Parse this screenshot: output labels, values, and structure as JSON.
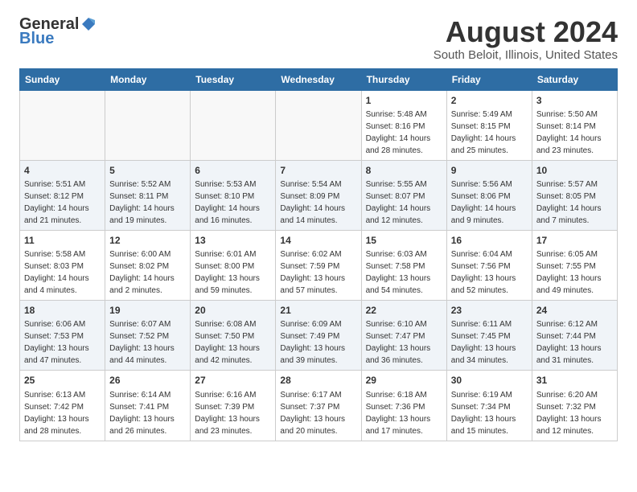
{
  "header": {
    "logo_general": "General",
    "logo_blue": "Blue",
    "title": "August 2024",
    "subtitle": "South Beloit, Illinois, United States"
  },
  "weekdays": [
    "Sunday",
    "Monday",
    "Tuesday",
    "Wednesday",
    "Thursday",
    "Friday",
    "Saturday"
  ],
  "weeks": [
    [
      {
        "day": "",
        "info": ""
      },
      {
        "day": "",
        "info": ""
      },
      {
        "day": "",
        "info": ""
      },
      {
        "day": "",
        "info": ""
      },
      {
        "day": "1",
        "info": "Sunrise: 5:48 AM\nSunset: 8:16 PM\nDaylight: 14 hours\nand 28 minutes."
      },
      {
        "day": "2",
        "info": "Sunrise: 5:49 AM\nSunset: 8:15 PM\nDaylight: 14 hours\nand 25 minutes."
      },
      {
        "day": "3",
        "info": "Sunrise: 5:50 AM\nSunset: 8:14 PM\nDaylight: 14 hours\nand 23 minutes."
      }
    ],
    [
      {
        "day": "4",
        "info": "Sunrise: 5:51 AM\nSunset: 8:12 PM\nDaylight: 14 hours\nand 21 minutes."
      },
      {
        "day": "5",
        "info": "Sunrise: 5:52 AM\nSunset: 8:11 PM\nDaylight: 14 hours\nand 19 minutes."
      },
      {
        "day": "6",
        "info": "Sunrise: 5:53 AM\nSunset: 8:10 PM\nDaylight: 14 hours\nand 16 minutes."
      },
      {
        "day": "7",
        "info": "Sunrise: 5:54 AM\nSunset: 8:09 PM\nDaylight: 14 hours\nand 14 minutes."
      },
      {
        "day": "8",
        "info": "Sunrise: 5:55 AM\nSunset: 8:07 PM\nDaylight: 14 hours\nand 12 minutes."
      },
      {
        "day": "9",
        "info": "Sunrise: 5:56 AM\nSunset: 8:06 PM\nDaylight: 14 hours\nand 9 minutes."
      },
      {
        "day": "10",
        "info": "Sunrise: 5:57 AM\nSunset: 8:05 PM\nDaylight: 14 hours\nand 7 minutes."
      }
    ],
    [
      {
        "day": "11",
        "info": "Sunrise: 5:58 AM\nSunset: 8:03 PM\nDaylight: 14 hours\nand 4 minutes."
      },
      {
        "day": "12",
        "info": "Sunrise: 6:00 AM\nSunset: 8:02 PM\nDaylight: 14 hours\nand 2 minutes."
      },
      {
        "day": "13",
        "info": "Sunrise: 6:01 AM\nSunset: 8:00 PM\nDaylight: 13 hours\nand 59 minutes."
      },
      {
        "day": "14",
        "info": "Sunrise: 6:02 AM\nSunset: 7:59 PM\nDaylight: 13 hours\nand 57 minutes."
      },
      {
        "day": "15",
        "info": "Sunrise: 6:03 AM\nSunset: 7:58 PM\nDaylight: 13 hours\nand 54 minutes."
      },
      {
        "day": "16",
        "info": "Sunrise: 6:04 AM\nSunset: 7:56 PM\nDaylight: 13 hours\nand 52 minutes."
      },
      {
        "day": "17",
        "info": "Sunrise: 6:05 AM\nSunset: 7:55 PM\nDaylight: 13 hours\nand 49 minutes."
      }
    ],
    [
      {
        "day": "18",
        "info": "Sunrise: 6:06 AM\nSunset: 7:53 PM\nDaylight: 13 hours\nand 47 minutes."
      },
      {
        "day": "19",
        "info": "Sunrise: 6:07 AM\nSunset: 7:52 PM\nDaylight: 13 hours\nand 44 minutes."
      },
      {
        "day": "20",
        "info": "Sunrise: 6:08 AM\nSunset: 7:50 PM\nDaylight: 13 hours\nand 42 minutes."
      },
      {
        "day": "21",
        "info": "Sunrise: 6:09 AM\nSunset: 7:49 PM\nDaylight: 13 hours\nand 39 minutes."
      },
      {
        "day": "22",
        "info": "Sunrise: 6:10 AM\nSunset: 7:47 PM\nDaylight: 13 hours\nand 36 minutes."
      },
      {
        "day": "23",
        "info": "Sunrise: 6:11 AM\nSunset: 7:45 PM\nDaylight: 13 hours\nand 34 minutes."
      },
      {
        "day": "24",
        "info": "Sunrise: 6:12 AM\nSunset: 7:44 PM\nDaylight: 13 hours\nand 31 minutes."
      }
    ],
    [
      {
        "day": "25",
        "info": "Sunrise: 6:13 AM\nSunset: 7:42 PM\nDaylight: 13 hours\nand 28 minutes."
      },
      {
        "day": "26",
        "info": "Sunrise: 6:14 AM\nSunset: 7:41 PM\nDaylight: 13 hours\nand 26 minutes."
      },
      {
        "day": "27",
        "info": "Sunrise: 6:16 AM\nSunset: 7:39 PM\nDaylight: 13 hours\nand 23 minutes."
      },
      {
        "day": "28",
        "info": "Sunrise: 6:17 AM\nSunset: 7:37 PM\nDaylight: 13 hours\nand 20 minutes."
      },
      {
        "day": "29",
        "info": "Sunrise: 6:18 AM\nSunset: 7:36 PM\nDaylight: 13 hours\nand 17 minutes."
      },
      {
        "day": "30",
        "info": "Sunrise: 6:19 AM\nSunset: 7:34 PM\nDaylight: 13 hours\nand 15 minutes."
      },
      {
        "day": "31",
        "info": "Sunrise: 6:20 AM\nSunset: 7:32 PM\nDaylight: 13 hours\nand 12 minutes."
      }
    ]
  ]
}
